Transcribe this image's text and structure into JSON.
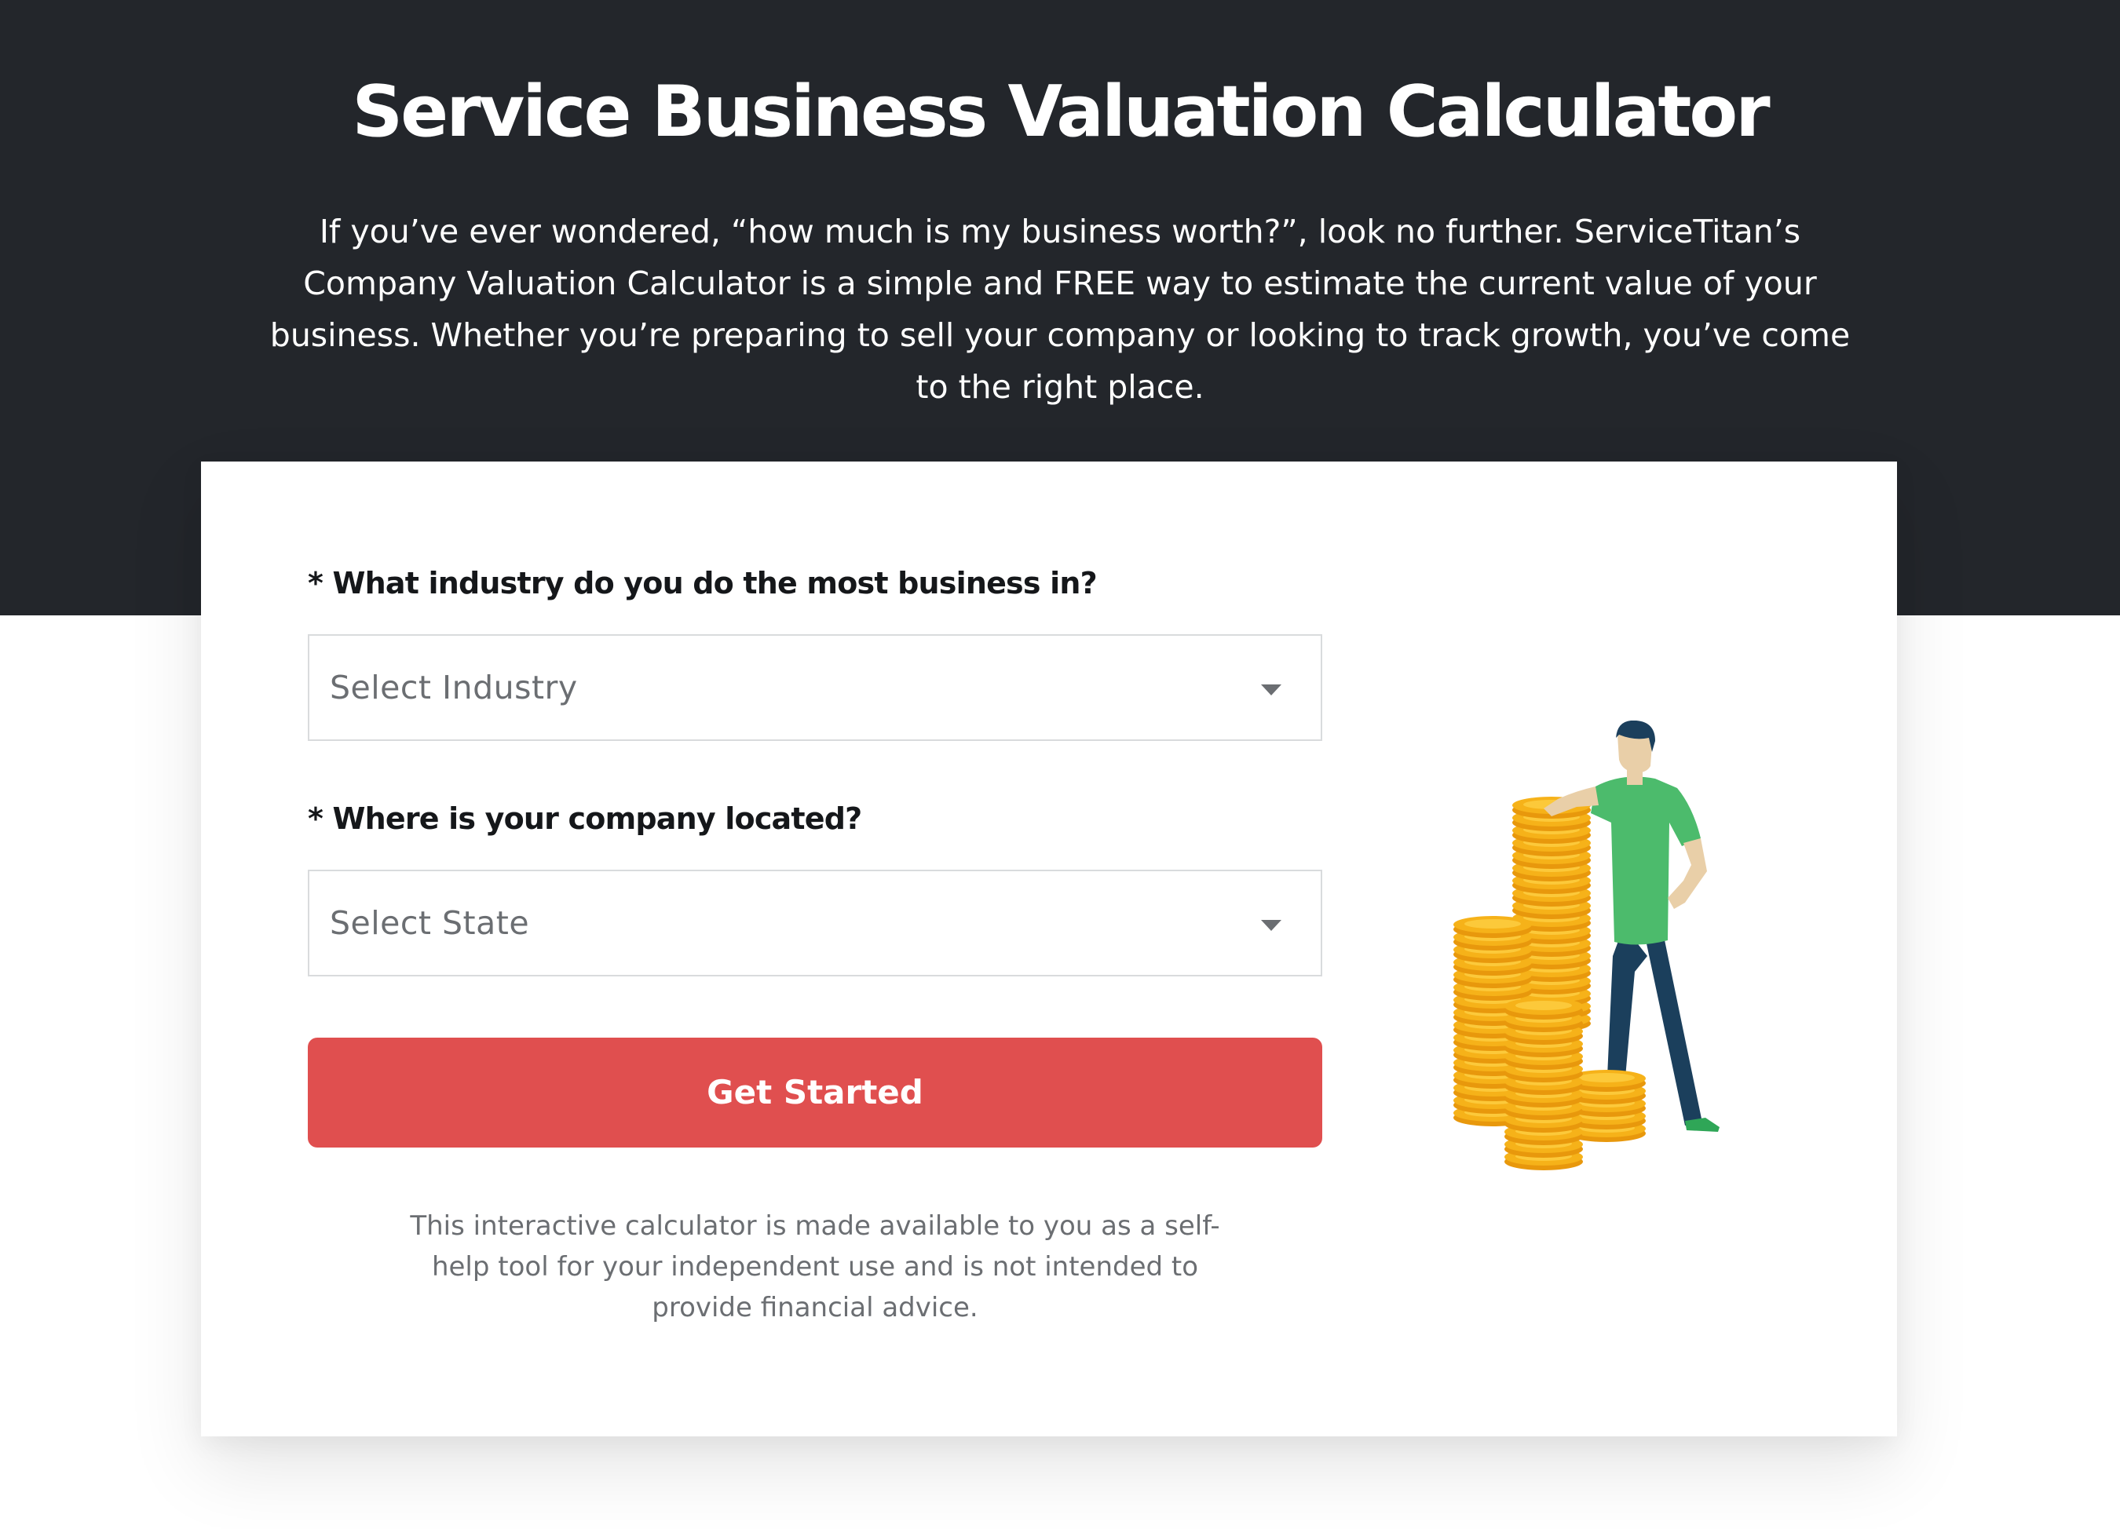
{
  "page": {
    "title": "Service Business Valuation Calculator",
    "intro": "If you’ve ever wondered, “how much is my business worth?”, look no further. ServiceTitan’s Company Valuation Calculator is a simple and FREE way to estimate the current value of your business. Whether you’re preparing to sell your company or looking to track growth, you’ve come to the right place."
  },
  "form": {
    "industry_label": "* What industry do you do the most business in?",
    "industry_selected": "Select Industry",
    "location_label": "* Where is your company located?",
    "location_selected": "Select State",
    "submit_label": "Get Started",
    "disclaimer": "This interactive calculator is made available to you as a self-help tool for your independent use and is not intended to provide financial advice."
  },
  "icons": {
    "dropdown_caret": "chevron-down-icon",
    "illustration": "man-leaning-on-coin-stacks"
  },
  "colors": {
    "hero_bg": "#23262b",
    "cta_bg": "#e04f4f",
    "coin": "#f6b219",
    "shirt": "#4cbb6c",
    "pants": "#1b3f5c"
  }
}
